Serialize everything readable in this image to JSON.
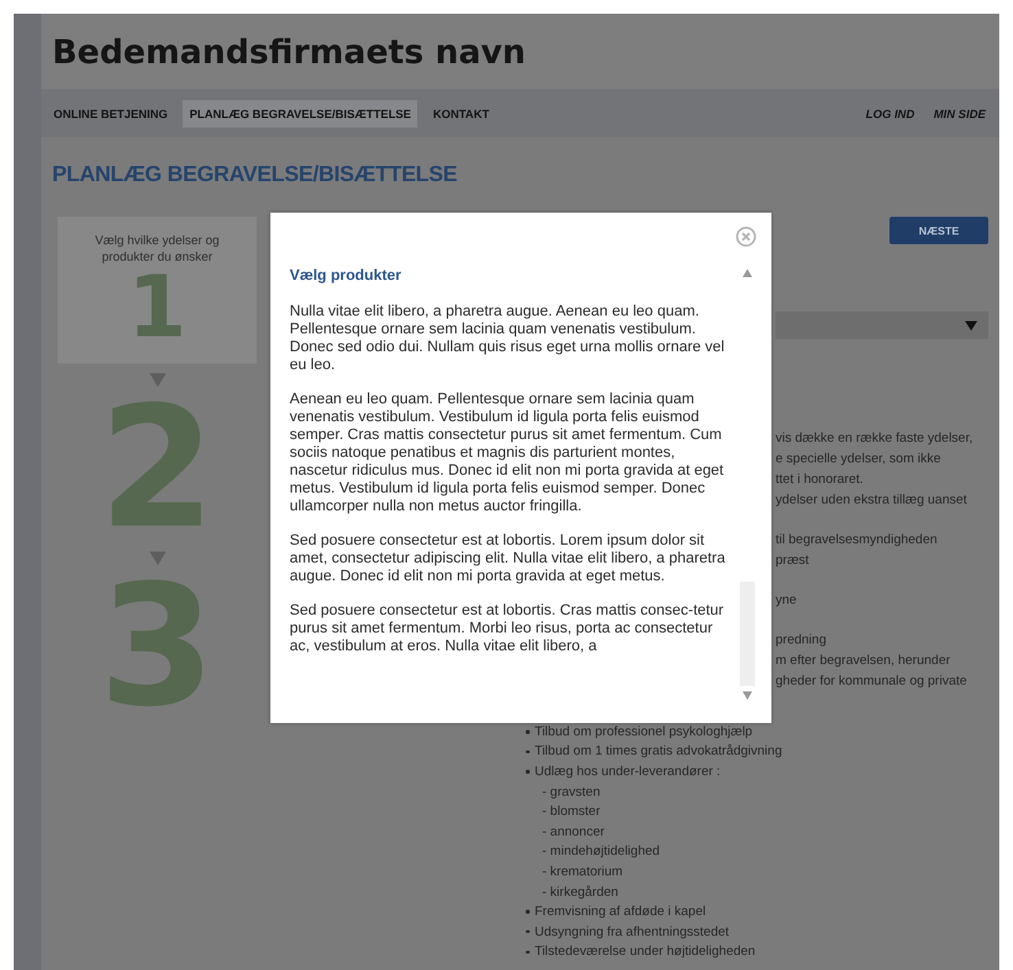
{
  "header": {
    "title": "Bedemandsfirmaets navn"
  },
  "nav": {
    "items": [
      {
        "label": "ONLINE BETJENING",
        "selected": false
      },
      {
        "label": "PLANLÆG BEGRAVELSE/BISÆTTELSE",
        "selected": true
      },
      {
        "label": "KONTAKT",
        "selected": false
      }
    ],
    "account_links": [
      "LOG IND",
      "MIN SIDE"
    ]
  },
  "page_title": "PLANLÆG BEGRAVELSE/BISÆTTELSE",
  "steps": [
    {
      "number": "1",
      "text": "Vælg hvilke ydelser og produkter du ønsker",
      "selected": true
    },
    {
      "number": "2",
      "selected": false
    },
    {
      "number": "3",
      "selected": false
    }
  ],
  "next_button": "NÆSTE",
  "partial_paragraphs": [
    [
      "vis dække en række faste ydelser,",
      "e specielle ydelser, som ikke",
      "ttet i honoraret.",
      "ydelser uden ekstra tillæg uanset"
    ],
    [
      "til begravelsesmyndigheden",
      "præst"
    ],
    [
      "yne"
    ],
    [
      "predning",
      "m efter begravelsen, herunder",
      "gheder for kommunale og private"
    ]
  ],
  "services": [
    {
      "text": "Tilbud om professionel psykologhjælp"
    },
    {
      "text": "Tilbud om 1 times gratis advokatrådgivning"
    },
    {
      "text": "Udlæg hos under-leverandører :",
      "children": [
        {
          "text": "- gravsten"
        },
        {
          "text": "- blomster"
        },
        {
          "text": "- annoncer"
        },
        {
          "text": "- mindehøjtidelighed"
        },
        {
          "text": "- krematorium"
        },
        {
          "text": "- kirkegården"
        }
      ]
    },
    {
      "text": "Fremvisning af afdøde i kapel"
    },
    {
      "text": "Udsyngning fra afhentningsstedet"
    },
    {
      "text": "Tilstedeværelse under højtideligheden"
    }
  ],
  "modal": {
    "title": "Vælg produkter",
    "paragraphs": [
      "Nulla vitae elit libero, a pharetra augue. Aenean eu leo quam. Pellentesque ornare sem lacinia quam venenatis vestibulum. Donec sed odio dui. Nullam quis risus eget urna mollis ornare vel eu leo.",
      "Aenean eu leo quam. Pellentesque ornare sem lacinia quam venenatis vestibulum. Vestibulum id ligula porta felis euismod semper. Cras mattis consectetur purus sit amet fermentum. Cum sociis natoque penatibus et magnis dis parturient montes, nascetur ridiculus mus. Donec id elit non mi porta gravida at eget metus. Vestibulum id ligula porta felis euismod semper. Donec ullamcorper nulla non metus auctor fringilla.",
      "Sed posuere consectetur est at lobortis. Lorem ipsum dolor sit amet, consectetur adipiscing elit. Nulla vitae elit libero, a pharetra augue. Donec id elit non mi porta gravida at eget metus.",
      "Sed posuere consectetur est at lobortis. Cras mattis consec-tetur purus sit amet fermentum. Morbi leo risus, porta ac consectetur ac, vestibulum at eros. Nulla vitae elit libero, a"
    ]
  }
}
